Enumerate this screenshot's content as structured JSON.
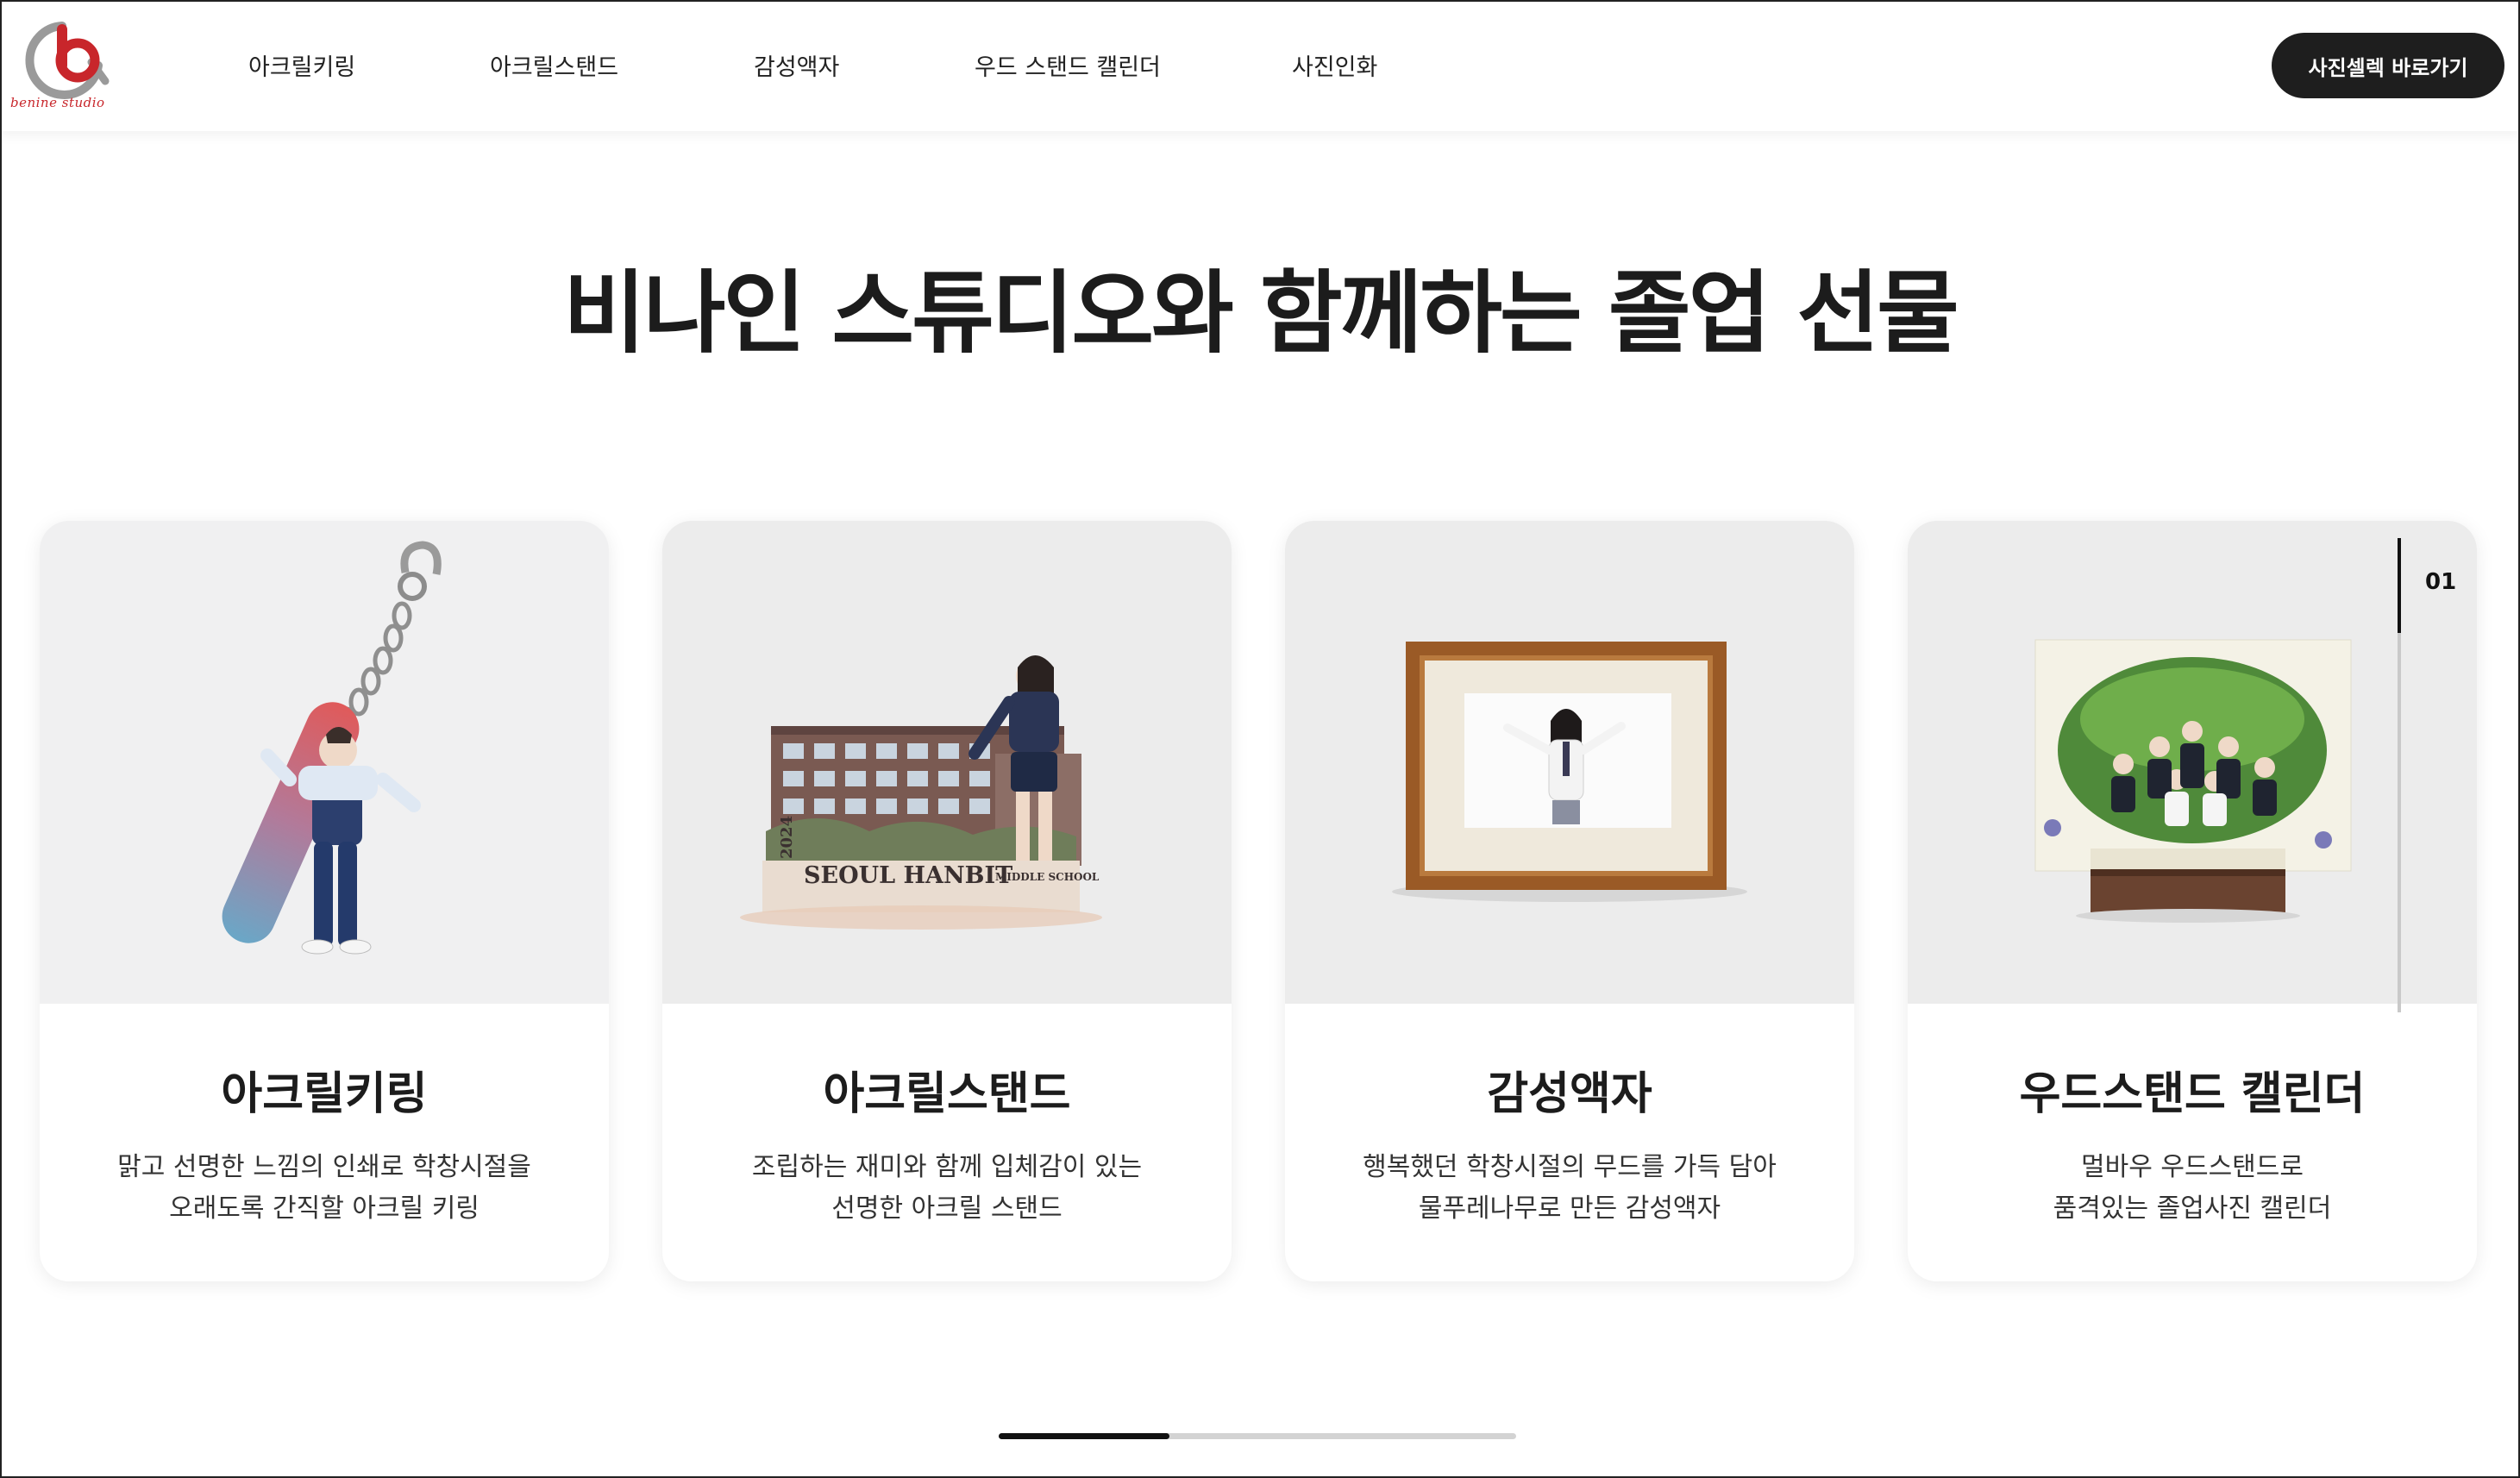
{
  "brand": {
    "logo_text": "benine studio",
    "accent": "#c8262b"
  },
  "nav": {
    "items": [
      {
        "label": "아크릴키링"
      },
      {
        "label": "아크릴스탠드"
      },
      {
        "label": "감성액자"
      },
      {
        "label": "우드 스탠드 캘린더"
      },
      {
        "label": "사진인화"
      }
    ],
    "cta_label": "사진셀렉 바로가기"
  },
  "main": {
    "title": "비나인 스튜디오와 함께하는 졸업 선물",
    "cards": [
      {
        "title": "아크릴키링",
        "desc_line1": "맑고 선명한 느낌의 인쇄로 학창시절을",
        "desc_line2": "오래도록 간직할 아크릴 키링"
      },
      {
        "title": "아크릴스탠드",
        "desc_line1": "조립하는 재미와 함께 입체감이 있는",
        "desc_line2": "선명한 아크릴 스탠드",
        "image_text": "SEOUL HANBIT",
        "image_subtext": "MIDDLE SCHOOL",
        "image_year": "2024"
      },
      {
        "title": "감성액자",
        "desc_line1": "행복했던 학창시절의 무드를 가득 담아",
        "desc_line2": "물푸레나무로 만든 감성액자"
      },
      {
        "title": "우드스탠드 캘린더",
        "desc_line1": "멀바우 우드스탠드로",
        "desc_line2": "품격있는 졸업사진 캘린더"
      }
    ],
    "slide_index": "01"
  },
  "scroll_progress": 0.33
}
